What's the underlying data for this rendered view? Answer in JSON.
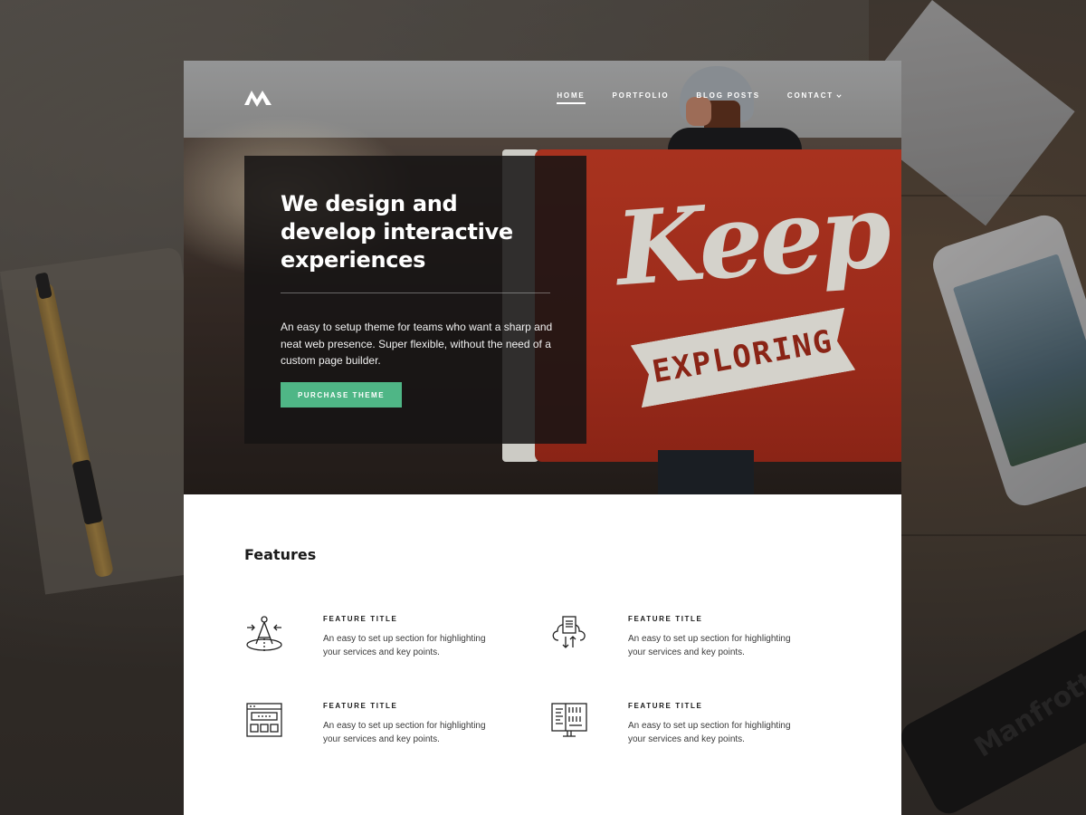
{
  "nav": {
    "items": [
      {
        "label": "HOME",
        "active": true
      },
      {
        "label": "PORTFOLIO"
      },
      {
        "label": "BLOG POSTS"
      },
      {
        "label": "CONTACT"
      }
    ]
  },
  "hero": {
    "headline": "We design and develop interactive experiences",
    "subtext": "An easy to setup theme for teams who want a sharp and neat web presence. Super flexible, without the need of a custom page builder.",
    "cta_label": "PURCHASE THEME",
    "flag_word": "Keep",
    "flag_ribbon": "EXPLORING"
  },
  "features": {
    "heading": "Features",
    "items": [
      {
        "icon": "drafting-compass-icon",
        "title": "FEATURE TITLE",
        "desc": "An easy to set up section for highlighting your services and key points."
      },
      {
        "icon": "cloud-document-icon",
        "title": "FEATURE TITLE",
        "desc": "An easy to set up section for highlighting your services and key points."
      },
      {
        "icon": "browser-layout-icon",
        "title": "FEATURE TITLE",
        "desc": "An easy to set up section for highlighting your services and key points."
      },
      {
        "icon": "binary-code-icon",
        "title": "FEATURE TITLE",
        "desc": "An easy to set up section for highlighting your services and key points."
      }
    ]
  },
  "backdrop": {
    "tripod_brand": "Manfrotto"
  },
  "colors": {
    "accent": "#4fb686",
    "flag": "#b3321f",
    "panel": "#161414"
  }
}
